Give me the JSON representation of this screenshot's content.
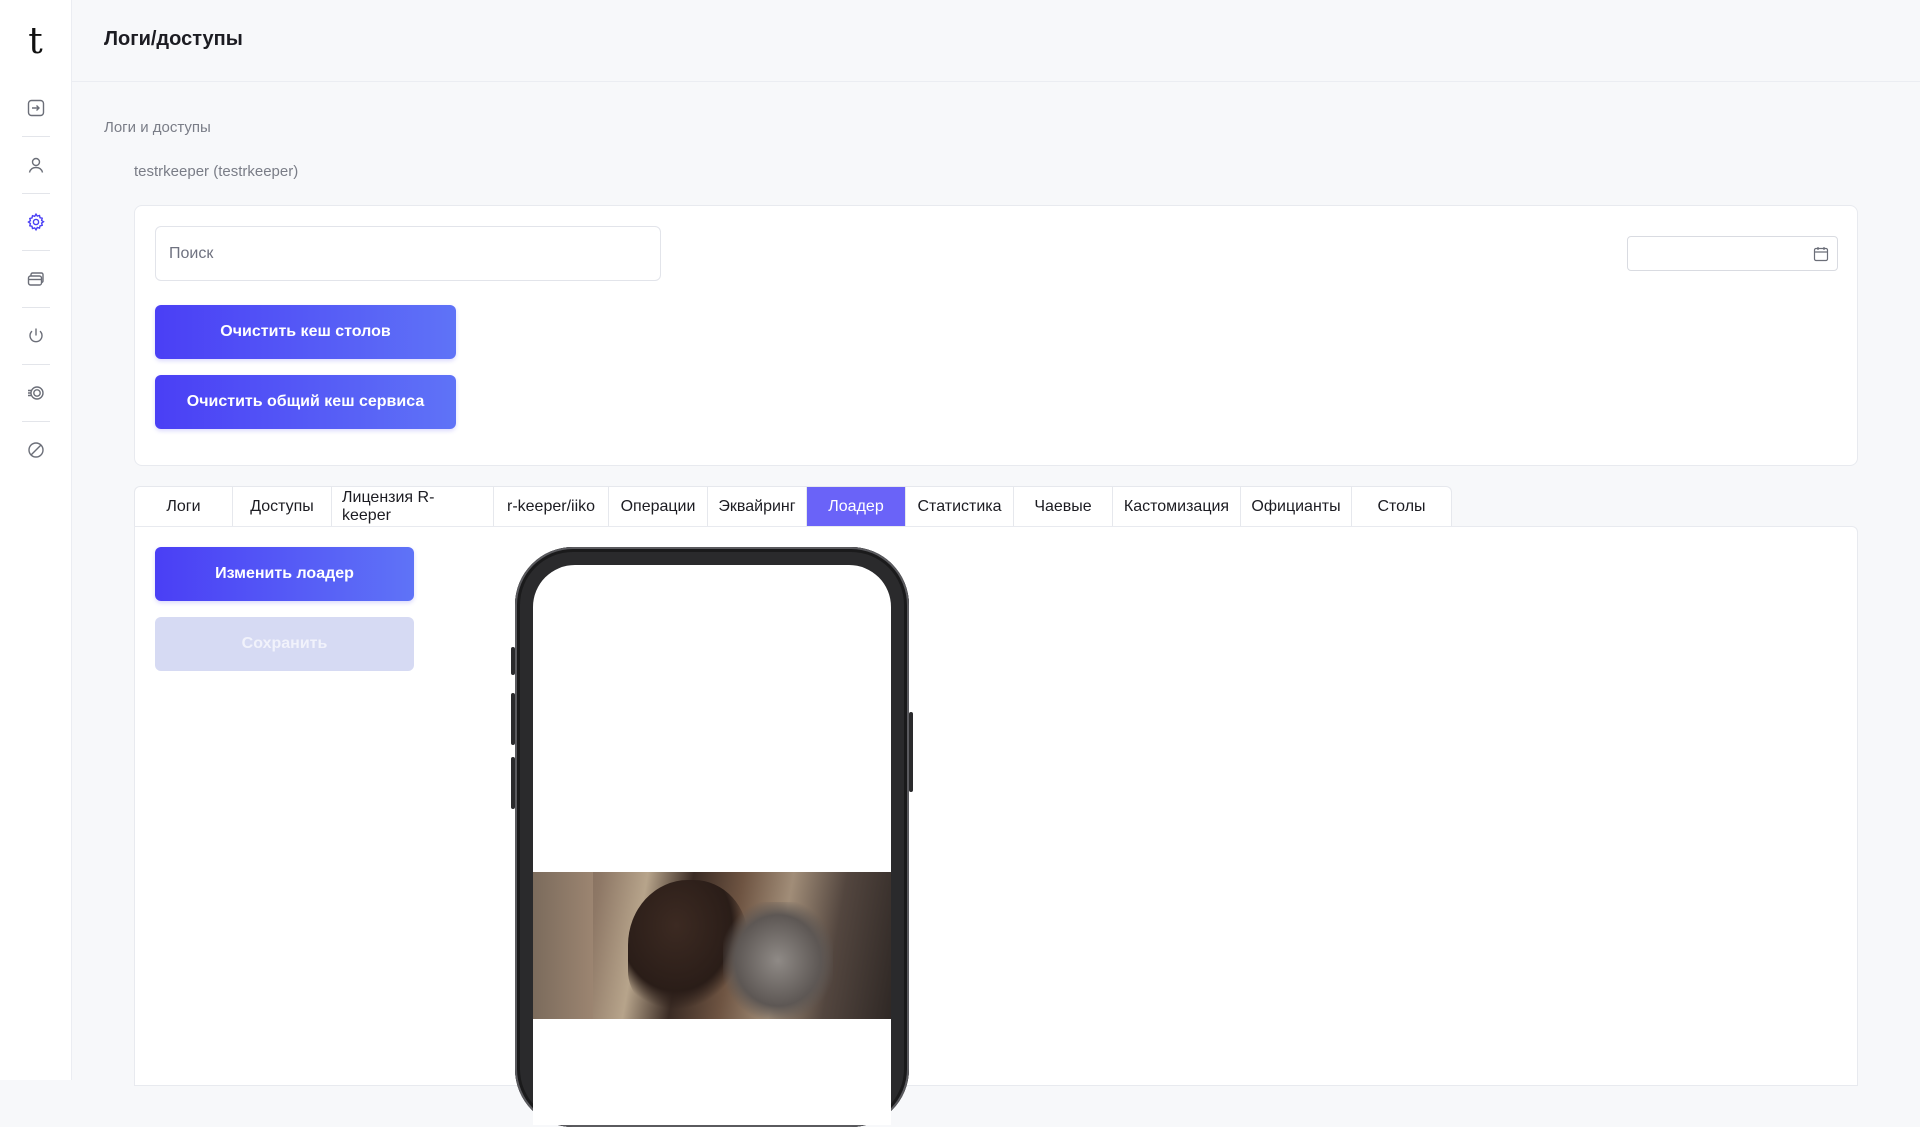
{
  "app": {
    "logo_text": "t"
  },
  "sidebar": {
    "items": [
      {
        "name": "logout-icon"
      },
      {
        "name": "user-icon"
      },
      {
        "name": "settings-icon",
        "active": true
      },
      {
        "name": "cards-icon"
      },
      {
        "name": "power-icon"
      },
      {
        "name": "coins-icon"
      },
      {
        "name": "blocked-icon"
      }
    ],
    "active_color": "#4a3ff5"
  },
  "header": {
    "title": "Логи/доступы"
  },
  "breadcrumb": "Логи и доступы",
  "account": "testrkeeper (testrkeeper)",
  "filters": {
    "search_placeholder": "Поиск",
    "date_value": "",
    "clear_tables_label": "Очистить кеш столов",
    "clear_service_label": "Очистить общий кеш сервиса"
  },
  "tabs": [
    {
      "label": "Логи"
    },
    {
      "label": "Доступы"
    },
    {
      "label": "Лицензия R-keeper"
    },
    {
      "label": "r-keeper/iiko"
    },
    {
      "label": "Операции"
    },
    {
      "label": "Эквайринг"
    },
    {
      "label": "Лоадер",
      "active": true
    },
    {
      "label": "Статистика"
    },
    {
      "label": "Чаевые"
    },
    {
      "label": "Кастомизация"
    },
    {
      "label": "Официанты"
    },
    {
      "label": "Столы"
    }
  ],
  "loader": {
    "change_label": "Изменить лоадер",
    "save_label": "Сохранить",
    "save_disabled": true
  },
  "colors": {
    "accent": "#4a3ff5",
    "accent_light": "#6a63f8",
    "disabled": "#d6daf3"
  }
}
